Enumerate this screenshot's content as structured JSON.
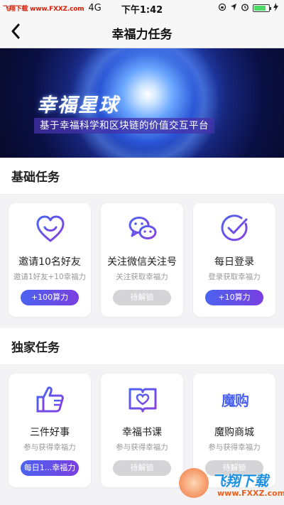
{
  "status_bar": {
    "brand": "飞翔下载 www.FXXZ.com",
    "network": "4G",
    "time": "下午1:42"
  },
  "nav": {
    "title": "幸福力任务"
  },
  "banner": {
    "title": "幸福星球",
    "subtitle": "基于幸福科学和区块链的价值交互平台"
  },
  "sections": [
    {
      "title": "基础任务",
      "cards": [
        {
          "icon": "heart-smile-icon",
          "title": "邀请10名好友",
          "desc": "邀请1好友+10幸福力",
          "button": "+100算力",
          "state": "active"
        },
        {
          "icon": "wechat-icon",
          "title": "关注微信关注号",
          "desc": "关注获取幸福力",
          "button": "待解锁",
          "state": "locked"
        },
        {
          "icon": "check-circle-icon",
          "title": "每日登录",
          "desc": "登录获取幸福力",
          "button": "+10算力",
          "state": "active"
        }
      ]
    },
    {
      "title": "独家任务",
      "cards": [
        {
          "icon": "thumbs-up-icon",
          "title": "三件好事",
          "desc": "参与获得幸福力",
          "button": "每日1...幸福力",
          "state": "active"
        },
        {
          "icon": "book-heart-icon",
          "title": "幸福书课",
          "desc": "参与获得幸福力",
          "button": "待解锁",
          "state": "locked"
        },
        {
          "icon": "mogou-logo-icon",
          "logo_text": "魔购",
          "title": "魔购商城",
          "desc": "参与获得幸福力",
          "button": "待解锁",
          "state": "locked"
        }
      ]
    }
  ],
  "watermark": {
    "text": "飞翔下载",
    "url": "www.FXXZ.com"
  },
  "colors": {
    "accent_start": "#4b63f0",
    "accent_end": "#7a3fe0",
    "locked": "#d5d5d8",
    "page_bg": "#f3f3f6"
  }
}
